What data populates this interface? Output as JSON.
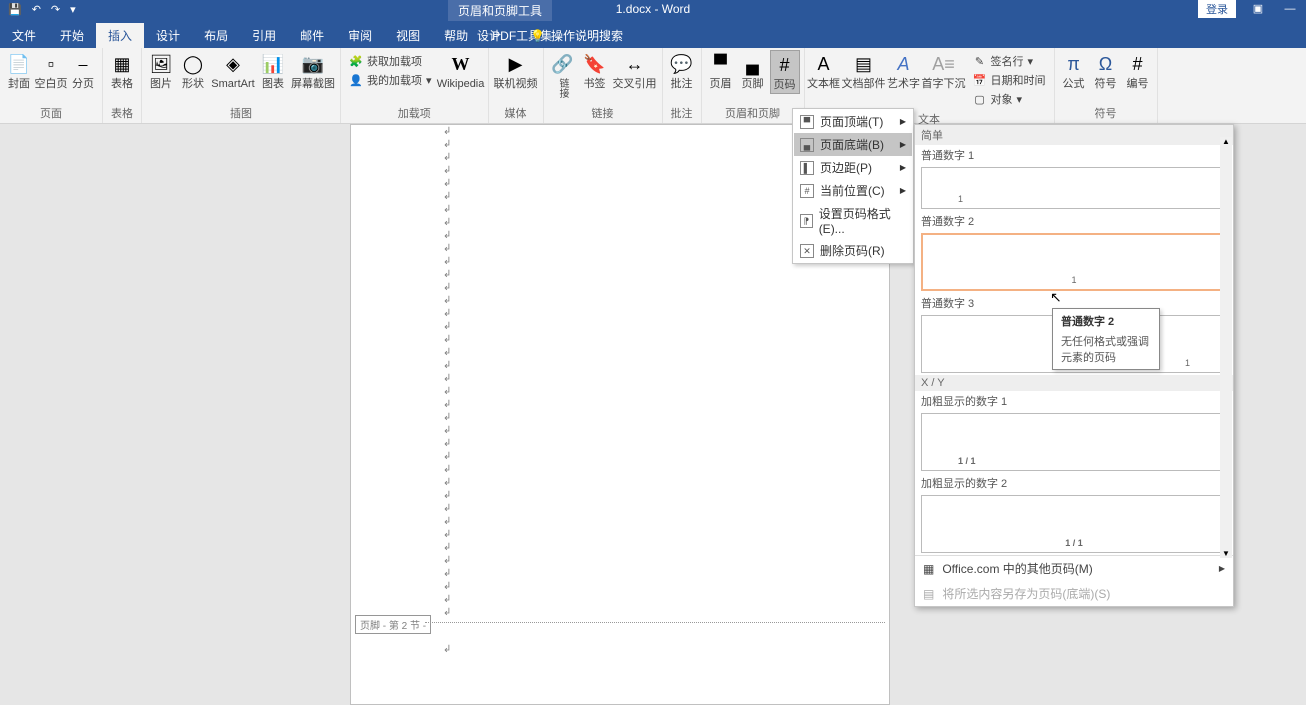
{
  "title_bar": {
    "context_tool": "页眉和页脚工具",
    "doc_title": "1.docx - Word",
    "login": "登录"
  },
  "tabs": {
    "file": "文件",
    "home": "开始",
    "insert": "插入",
    "design": "设计",
    "layout": "布局",
    "references": "引用",
    "mailings": "邮件",
    "review": "审阅",
    "view": "视图",
    "help": "帮助",
    "pdf": "PDF工具集",
    "design_ctx": "设计",
    "tellme": "操作说明搜索"
  },
  "ribbon": {
    "pages": {
      "label": "页面",
      "cover": "封面",
      "blank": "空白页",
      "break": "分页"
    },
    "tables": {
      "label": "表格",
      "table": "表格"
    },
    "illus": {
      "label": "插图",
      "pic": "图片",
      "shape": "形状",
      "smartart": "SmartArt",
      "chart": "图表",
      "screenshot": "屏幕截图"
    },
    "addins": {
      "label": "加载项",
      "get": "获取加载项",
      "my": "我的加载项",
      "wiki": "Wikipedia"
    },
    "media": {
      "label": "媒体",
      "video": "联机视频"
    },
    "links": {
      "label": "链接",
      "link": "链接",
      "bookmark": "书签",
      "crossref": "交叉引用"
    },
    "comments": {
      "label": "批注",
      "comment": "批注"
    },
    "hf": {
      "label": "页眉和页脚",
      "header": "页眉",
      "footer": "页脚",
      "pagenum": "页码"
    },
    "text": {
      "label": "文本",
      "textbox": "文本框",
      "quickparts": "文档部件",
      "wordart": "艺术字",
      "dropcap": "首字下沉",
      "sigline": "签名行",
      "datetime": "日期和时间",
      "object": "对象"
    },
    "symbols": {
      "label": "符号",
      "equation": "公式",
      "symbol": "符号",
      "number": "编号"
    }
  },
  "dropdown": {
    "top": "页面顶端(T)",
    "bottom": "页面底端(B)",
    "margins": "页边距(P)",
    "current": "当前位置(C)",
    "format": "设置页码格式(E)...",
    "remove": "删除页码(R)"
  },
  "gallery": {
    "simple": "简单",
    "plain1": "普通数字 1",
    "plain2": "普通数字 2",
    "plain3": "普通数字 3",
    "xy_header": "X / Y",
    "bold1": "加粗显示的数字 1",
    "bold2": "加粗显示的数字 2",
    "xy_val": "1 / 1",
    "more": "Office.com 中的其他页码(M)",
    "save": "将所选内容另存为页码(底端)(S)"
  },
  "tooltip": {
    "title": "普通数字 2",
    "desc": "无任何格式或强调元素的页码"
  },
  "doc": {
    "footer_label": "页脚 - 第 2 节 -"
  }
}
